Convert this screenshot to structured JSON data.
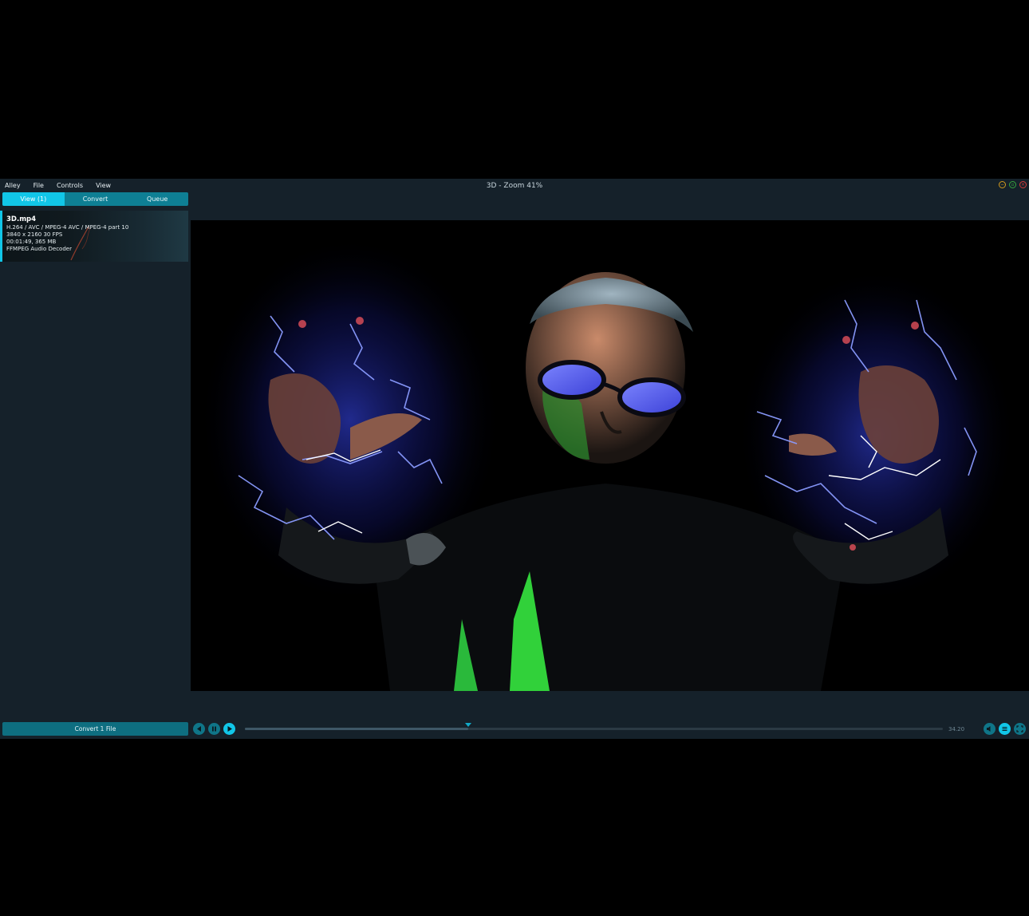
{
  "app": {
    "window_title": "3D - Zoom 41%",
    "menu": [
      "Alley",
      "File",
      "Controls",
      "View"
    ]
  },
  "tabs": [
    {
      "label": "View (1)",
      "active": true
    },
    {
      "label": "Convert",
      "active": false
    },
    {
      "label": "Queue",
      "active": false
    }
  ],
  "file": {
    "name": "3D.mp4",
    "codec": "H.264 / AVC / MPEG-4 AVC / MPEG-4 part 10",
    "resolution": "3840 x 2160 30 FPS",
    "duration_size": "00:01:49, 365 MB",
    "audio": "FFMPEG Audio Decoder"
  },
  "footer": {
    "convert_label": "Convert 1 File",
    "time": "34.20",
    "playhead_fraction": 0.32
  },
  "colors": {
    "accent": "#11c6e8",
    "accent_dark": "#0e7f94",
    "panel": "#15212a",
    "minimize": "#d39a1d",
    "maximize": "#35a33e",
    "close": "#d33b3b"
  },
  "icons": {
    "prev": "skip-back-icon",
    "pause": "pause-icon",
    "play": "play-icon",
    "volume": "volume-icon",
    "playlist": "playlist-icon",
    "fullscreen": "fullscreen-icon"
  }
}
